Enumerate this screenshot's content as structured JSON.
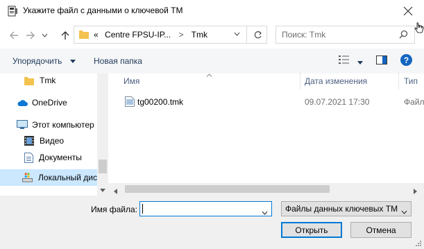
{
  "window": {
    "title": "Укажите файл с данными о ключевой ТМ"
  },
  "nav": {
    "path_prefix": "«",
    "breadcrumb": [
      "Centre FPSU-IP...",
      "Tmk"
    ],
    "search_placeholder": "Поиск: Tmk"
  },
  "toolbar": {
    "organize_label": "Упорядочить",
    "new_folder_label": "Новая папка",
    "help_label": "?"
  },
  "sidebar": {
    "items": [
      {
        "label": "Tmk",
        "icon": "folder-icon",
        "selected": false
      },
      {
        "label": "OneDrive",
        "icon": "cloud-icon",
        "selected": false
      },
      {
        "label": "Этот компьютер",
        "icon": "computer-icon",
        "selected": false
      },
      {
        "label": "Видео",
        "icon": "video-icon",
        "selected": false
      },
      {
        "label": "Документы",
        "icon": "document-icon",
        "selected": false
      },
      {
        "label": "Локальный дис",
        "icon": "drive-icon",
        "selected": true
      }
    ]
  },
  "columns": {
    "name": "Имя",
    "date": "Дата изменения",
    "type": "Тип"
  },
  "files": [
    {
      "name": "tg00200.tmk",
      "date": "09.07.2021 17:30",
      "type": "Файл"
    }
  ],
  "bottom": {
    "filename_label": "Имя файла:",
    "filename_value": "",
    "filter_value": "Файлы данных ключевых ТМ",
    "open_label": "Открыть",
    "cancel_label": "Отмена"
  },
  "colors": {
    "accent": "#0078d7",
    "selection": "#cce8ff",
    "help_blue": "#1565c0",
    "folder_yellow": "#f3c24f"
  }
}
